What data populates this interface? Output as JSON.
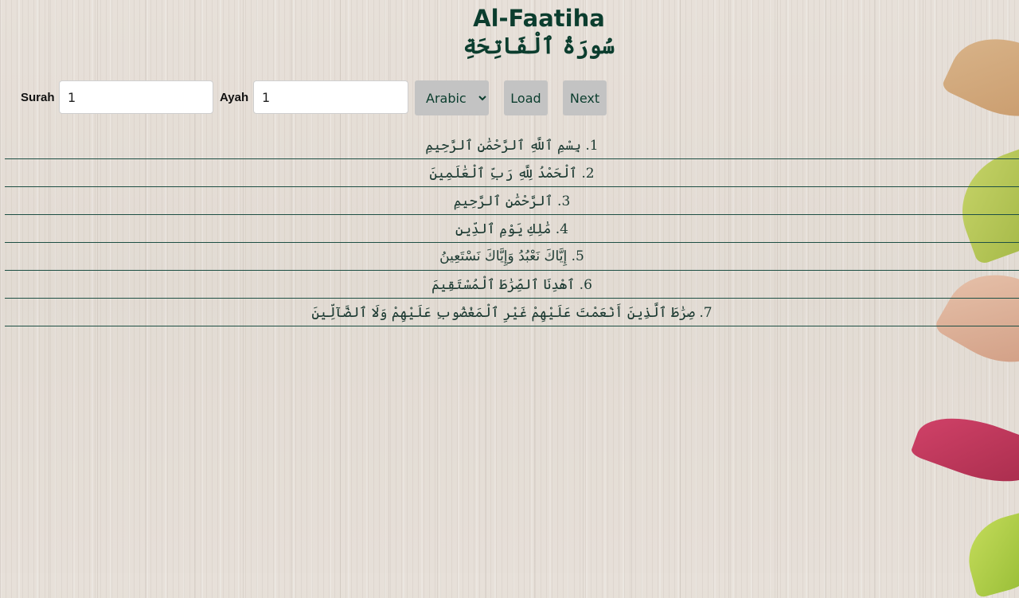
{
  "header": {
    "title_en": "Al-Faatiha",
    "title_ar": "سُورَةُ ٱلْفَاتِحَةِ"
  },
  "controls": {
    "surah_label": "Surah",
    "surah_value": "1",
    "ayah_label": "Ayah",
    "ayah_value": "1",
    "language_selected": "Arabic",
    "load_label": "Load",
    "next_label": "Next"
  },
  "ayahs": [
    {
      "text": "1. بِسْمِ ٱللَّهِ ٱلرَّحْمَٰنِ ٱلرَّحِيمِ"
    },
    {
      "text": "2. ٱلْحَمْدُ لِلَّهِ رَبِّ ٱلْعَٰلَمِينَ"
    },
    {
      "text": "3. ٱلرَّحْمَٰنِ ٱلرَّحِيمِ"
    },
    {
      "text": "4. مَٰلِكِ يَوْمِ ٱلدِّينِ"
    },
    {
      "text": "5. إِيَّاكَ نَعْبُدُ وَإِيَّاكَ نَسْتَعِينُ"
    },
    {
      "text": "6. ٱهْدِنَا ٱلصِّرَٰطَ ٱلْمُسْتَقِيمَ"
    },
    {
      "text": "7. صِرَٰطَ ٱلَّذِينَ أَنْعَمْتَ عَلَيْهِمْ غَيْرِ ٱلْمَغْضُوبِ عَلَيْهِمْ وَلَا ٱلضَّآلِّينَ"
    }
  ],
  "colors": {
    "title_green": "#0b3d2e",
    "button_gray": "#c3c3c3",
    "divider_green": "#1d4f44"
  }
}
